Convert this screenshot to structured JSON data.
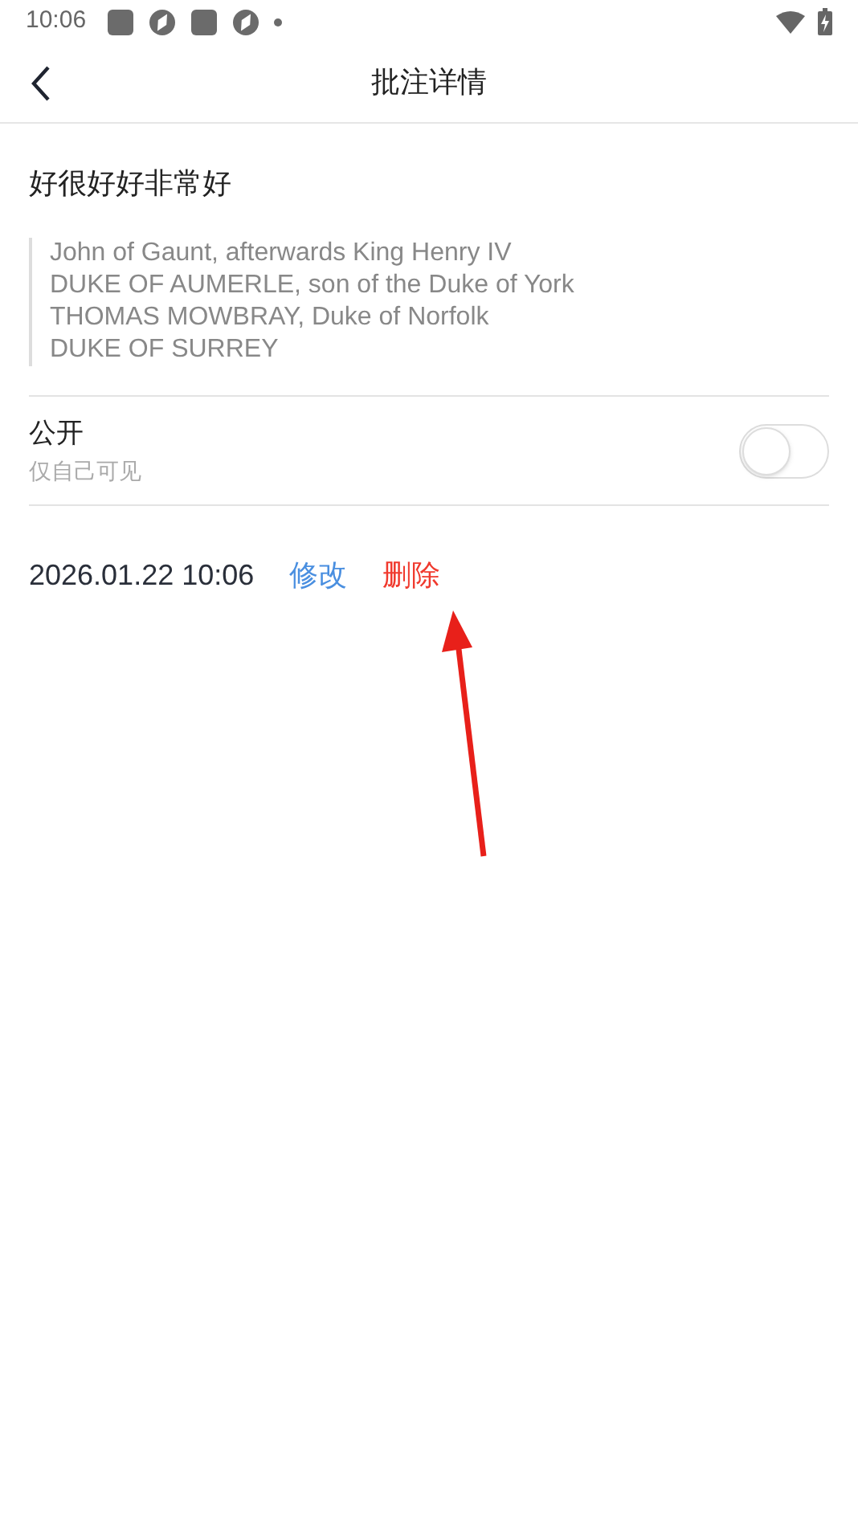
{
  "status_bar": {
    "time": "10:06"
  },
  "header": {
    "title": "批注详情"
  },
  "note": {
    "text": "好很好好非常好",
    "quote_lines": [
      "John of Gaunt, afterwards King Henry IV",
      "DUKE OF AUMERLE, son of the Duke of York",
      "THOMAS MOWBRAY, Duke of Norfolk",
      "DUKE OF SURREY"
    ]
  },
  "visibility": {
    "label": "公开",
    "hint": "仅自己可见",
    "on": false
  },
  "footer": {
    "date": "2026.01.22 10:06",
    "actions": [
      {
        "label": "修改",
        "kind": "edit"
      },
      {
        "label": "删除",
        "kind": "delete"
      }
    ]
  }
}
